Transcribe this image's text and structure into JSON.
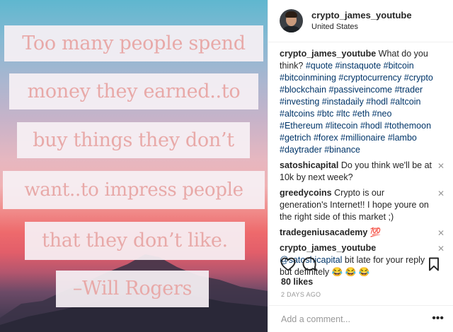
{
  "post": {
    "quote_lines": [
      "Too many people spend",
      "money they earned..to",
      "buy things they don’t",
      "want..to impress people",
      "that they don’t like.",
      "–Will Rogers"
    ]
  },
  "header": {
    "username": "crypto_james_youtube",
    "location": "United States"
  },
  "caption": {
    "username": "crypto_james_youtube",
    "text": "What do you think?",
    "hashtags": "#quote #instaquote #bitcoin #bitcoinmining #cryptocurrency #crypto #blockchain #passiveincome #trader #investing #instadaily #hodl #altcoin #altcoins #btc #ltc #eth #neo #Ethereum #litecoin #hodl #tothemoon #getrich #forex #millionaire #lambo #daytrader #binance"
  },
  "comments": [
    {
      "username": "satoshicapital",
      "text": "Do you think we'll be at 10k by next week?"
    },
    {
      "username": "greedycoins",
      "text": "Crypto is our generation's Internet!! I hope youre on the right side of this market ;)"
    },
    {
      "username": "tradegeniusacademy",
      "text": "💯"
    },
    {
      "username": "crypto_james_youtube",
      "mention": "@satoshicapital",
      "text": "bit late for your reply but definitely 😂 😂 😂"
    }
  ],
  "actions": {
    "likes": "80 likes",
    "time_ago": "2 DAYS AGO"
  },
  "comment_box": {
    "placeholder": "Add a comment...",
    "more_label": "•••"
  },
  "icons": {
    "like": "heart-icon",
    "comment": "comment-bubble-icon",
    "save": "bookmark-icon",
    "delete": "close-icon",
    "more": "more-options-icon"
  },
  "colors": {
    "link": "#003569",
    "muted": "#999999",
    "text": "#262626"
  }
}
